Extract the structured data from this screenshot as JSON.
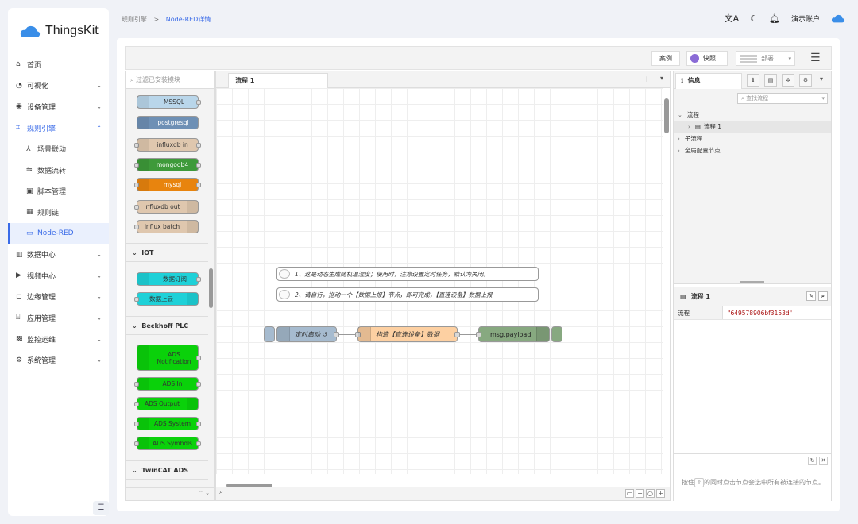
{
  "app": {
    "brand": "ThingsKit",
    "brand_color": "#3a6be8"
  },
  "breadcrumb": {
    "parent": "规则引擎",
    "separator": ">",
    "current": "Node-RED详情"
  },
  "header": {
    "account": "演示账户"
  },
  "menu": [
    {
      "label": "首页",
      "icon": "home-icon"
    },
    {
      "label": "可视化",
      "icon": "dashboard-icon",
      "chev": "⌄"
    },
    {
      "label": "设备管理",
      "icon": "device-icon",
      "chev": "⌄"
    },
    {
      "label": "规则引擎",
      "icon": "rule-icon",
      "chev": "⌃"
    },
    {
      "label": "场景联动",
      "icon": "scene-icon"
    },
    {
      "label": "数据流转",
      "icon": "flow-icon"
    },
    {
      "label": "脚本管理",
      "icon": "script-icon"
    },
    {
      "label": "规则链",
      "icon": "chain-icon"
    },
    {
      "label": "Node-RED",
      "icon": "node-red-icon"
    },
    {
      "label": "数据中心",
      "icon": "data-icon",
      "chev": "⌄"
    },
    {
      "label": "视频中心",
      "icon": "video-icon",
      "chev": "⌄"
    },
    {
      "label": "边缘管理",
      "icon": "edge-icon",
      "chev": "⌄"
    },
    {
      "label": "应用管理",
      "icon": "app-icon",
      "chev": "⌄"
    },
    {
      "label": "监控运维",
      "icon": "monitor-icon",
      "chev": "⌄"
    },
    {
      "label": "系统管理",
      "icon": "settings-icon",
      "chev": "⌄"
    }
  ],
  "toolbar": {
    "case_label": "案例",
    "snapshot_label": "快照",
    "deploy_label": "部署"
  },
  "palette": {
    "search_placeholder": "过滤已安装模块",
    "nodes": [
      "MSSQL",
      "postgresql",
      "influxdb in",
      "mongodb4",
      "mysql",
      "influxdb out",
      "influx batch"
    ],
    "cat_iot": "IOT",
    "iot_nodes": [
      "数据订阅",
      "数据上云"
    ],
    "cat_beckhoff": "Beckhoff PLC",
    "beckhoff_nodes": [
      "ADS Notification",
      "ADS In",
      "ADS Output",
      "ADS System",
      "ADS Symbols"
    ],
    "cat_twincat": "TwinCAT ADS"
  },
  "workspace": {
    "tab_label": "流程 1",
    "comments": [
      "1、这是动态生成随机温湿度；使用时，注意设置定时任务，默认为关闭。",
      "2、请自行，拖动一个【数据上报】节点，即可完成，【直连设备】数据上报"
    ],
    "nodes": {
      "inject": "定时启动 ↺",
      "function": "构造【直连设备】数据",
      "debug": "msg.payload"
    }
  },
  "sidebar": {
    "tab_label": "信息",
    "search_placeholder": "查找流程",
    "tree": {
      "flows": "流程",
      "flow1": "流程 1",
      "subflows": "子流程",
      "global": "全局配置节点"
    },
    "info_title": "流程 1",
    "info_key": "流程",
    "info_value": "\"649578906bf3153d\"",
    "help_text_1": "按住",
    "help_key": "⇧",
    "help_text_2": "的同时点击节点会选中所有被连接的节点。"
  }
}
